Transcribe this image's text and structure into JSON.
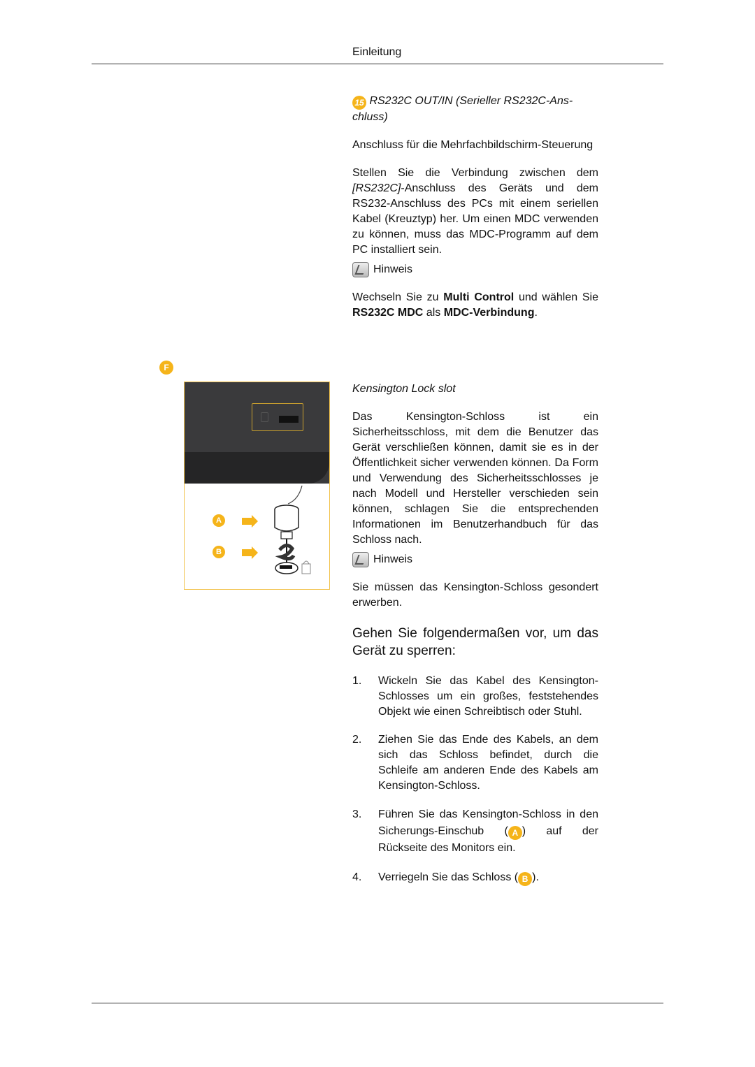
{
  "header": {
    "title": "Einleitung"
  },
  "section_rs232": {
    "badge": "15",
    "title": "RS232C OUT/IN (Serieller RS232C-Anschluss)",
    "title_line1": "RS232C OUT/IN (Serieller RS232C-Ans-",
    "title_line2": "chluss)",
    "description": "Anschluss für die Mehrfachbildschirm-Steuerung",
    "body_italic": "[RS232C]",
    "body_before": "Stellen Sie die Verbindung zwischen dem ",
    "body_after": "-Anschluss des Geräts und dem RS232-Anschluss des PCs mit einem seriellen Kabel (Kreuztyp) her. Um einen MDC verwenden zu können, muss das MDC-Programm auf dem PC installiert sein.",
    "note_label": "Hinweis",
    "note": {
      "p1": "Wechseln Sie zu ",
      "b1": "Multi Control",
      "p2": " und wählen Sie ",
      "b2": "RS232C MDC",
      "p3": " als ",
      "b3": "MDC-Verbindung",
      "p4": "."
    }
  },
  "figure": {
    "badge": "F",
    "label_a": "A",
    "label_b": "B"
  },
  "section_kensington": {
    "title": "Kensington Lock slot",
    "body": "Das Kensington-Schloss ist ein Sicherheitsschloss, mit dem die Benutzer das Gerät verschließen können, damit sie es in der Öffentlichkeit sicher verwenden können. Da Form und Verwendung des Sicherheitsschlosses je nach Modell und Hersteller verschieden sein können, schlagen Sie die entsprechenden Informationen im Benutzerhandbuch für das Schloss nach.",
    "note_label": "Hinweis",
    "note_text": "Sie müssen das Kensington-Schloss gesondert erwerben."
  },
  "procedure": {
    "heading": "Gehen Sie folgendermaßen vor, um das Gerät zu sperren:",
    "steps": [
      {
        "num": "1.",
        "text": "Wickeln Sie das Kabel des Kensington-Schlosses um ein großes, feststehendes Objekt wie einen Schreibtisch oder Stuhl."
      },
      {
        "num": "2.",
        "text": "Ziehen Sie das Ende des Kabels, an dem sich das Schloss befindet, durch die Schleife am anderen Ende des Kabels am Kensington-Schloss."
      },
      {
        "num": "3.",
        "text_before": "Führen Sie das Kensington-Schloss in den Sicherungs-Einschub (",
        "badge": "A",
        "text_after": ") auf der Rückseite des Monitors ein."
      },
      {
        "num": "4.",
        "text_before": "Verriegeln Sie das Schloss (",
        "badge": "B",
        "text_after": ")."
      }
    ]
  },
  "colors": {
    "accent": "#f5b41a",
    "frame": "#f2c24b"
  }
}
